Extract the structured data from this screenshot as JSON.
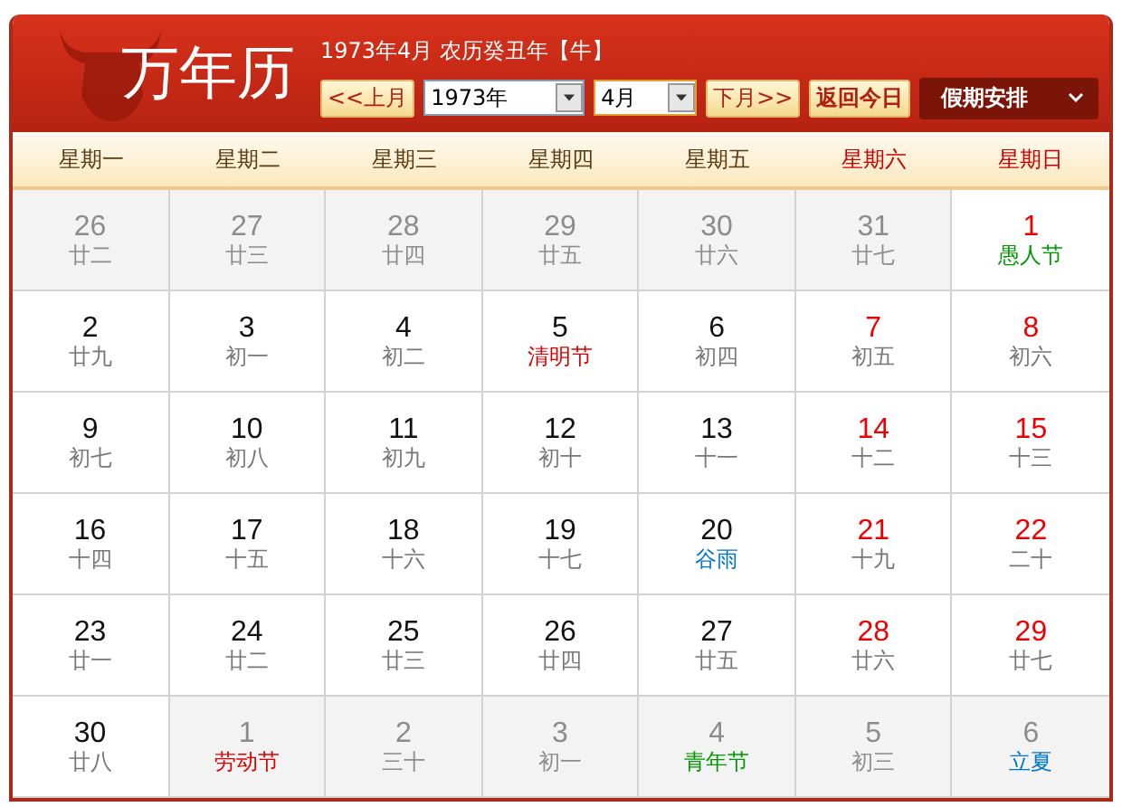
{
  "logo": {
    "title": "万年历"
  },
  "header": {
    "title": "1973年4月 农历癸丑年【牛】",
    "prev_button": "<<上月",
    "year_select": "1973年",
    "month_select": "4月",
    "next_button": "下月>>",
    "today_button": "返回今日",
    "holiday_menu": "假期安排"
  },
  "weekdays": [
    {
      "label": "星期一",
      "weekend": false
    },
    {
      "label": "星期二",
      "weekend": false
    },
    {
      "label": "星期三",
      "weekend": false
    },
    {
      "label": "星期四",
      "weekend": false
    },
    {
      "label": "星期五",
      "weekend": false
    },
    {
      "label": "星期六",
      "weekend": true
    },
    {
      "label": "星期日",
      "weekend": true
    }
  ],
  "days": [
    {
      "day": "26",
      "sub": "廿二",
      "in_month": false
    },
    {
      "day": "27",
      "sub": "廿三",
      "in_month": false
    },
    {
      "day": "28",
      "sub": "廿四",
      "in_month": false
    },
    {
      "day": "29",
      "sub": "廿五",
      "in_month": false
    },
    {
      "day": "30",
      "sub": "廿六",
      "in_month": false
    },
    {
      "day": "31",
      "sub": "廿七",
      "in_month": false
    },
    {
      "day": "1",
      "sub": "愚人节",
      "in_month": true,
      "color": "#009900"
    },
    {
      "day": "2",
      "sub": "廿九",
      "in_month": true
    },
    {
      "day": "3",
      "sub": "初一",
      "in_month": true
    },
    {
      "day": "4",
      "sub": "初二",
      "in_month": true
    },
    {
      "day": "5",
      "sub": "清明节",
      "in_month": true,
      "color": "#dd0000"
    },
    {
      "day": "6",
      "sub": "初四",
      "in_month": true
    },
    {
      "day": "7",
      "sub": "初五",
      "in_month": true
    },
    {
      "day": "8",
      "sub": "初六",
      "in_month": true
    },
    {
      "day": "9",
      "sub": "初七",
      "in_month": true
    },
    {
      "day": "10",
      "sub": "初八",
      "in_month": true
    },
    {
      "day": "11",
      "sub": "初九",
      "in_month": true
    },
    {
      "day": "12",
      "sub": "初十",
      "in_month": true
    },
    {
      "day": "13",
      "sub": "十一",
      "in_month": true
    },
    {
      "day": "14",
      "sub": "十二",
      "in_month": true
    },
    {
      "day": "15",
      "sub": "十三",
      "in_month": true
    },
    {
      "day": "16",
      "sub": "十四",
      "in_month": true
    },
    {
      "day": "17",
      "sub": "十五",
      "in_month": true
    },
    {
      "day": "18",
      "sub": "十六",
      "in_month": true
    },
    {
      "day": "19",
      "sub": "十七",
      "in_month": true
    },
    {
      "day": "20",
      "sub": "谷雨",
      "in_month": true,
      "color": "#0077cc"
    },
    {
      "day": "21",
      "sub": "十九",
      "in_month": true
    },
    {
      "day": "22",
      "sub": "二十",
      "in_month": true
    },
    {
      "day": "23",
      "sub": "廿一",
      "in_month": true
    },
    {
      "day": "24",
      "sub": "廿二",
      "in_month": true
    },
    {
      "day": "25",
      "sub": "廿三",
      "in_month": true
    },
    {
      "day": "26",
      "sub": "廿四",
      "in_month": true
    },
    {
      "day": "27",
      "sub": "廿五",
      "in_month": true
    },
    {
      "day": "28",
      "sub": "廿六",
      "in_month": true
    },
    {
      "day": "29",
      "sub": "廿七",
      "in_month": true
    },
    {
      "day": "30",
      "sub": "廿八",
      "in_month": true
    },
    {
      "day": "1",
      "sub": "劳动节",
      "in_month": false,
      "color": "#dd0000"
    },
    {
      "day": "2",
      "sub": "三十",
      "in_month": false
    },
    {
      "day": "3",
      "sub": "初一",
      "in_month": false
    },
    {
      "day": "4",
      "sub": "青年节",
      "in_month": false,
      "color": "#009900"
    },
    {
      "day": "5",
      "sub": "初三",
      "in_month": false
    },
    {
      "day": "6",
      "sub": "立夏",
      "in_month": false,
      "color": "#0077cc"
    }
  ]
}
